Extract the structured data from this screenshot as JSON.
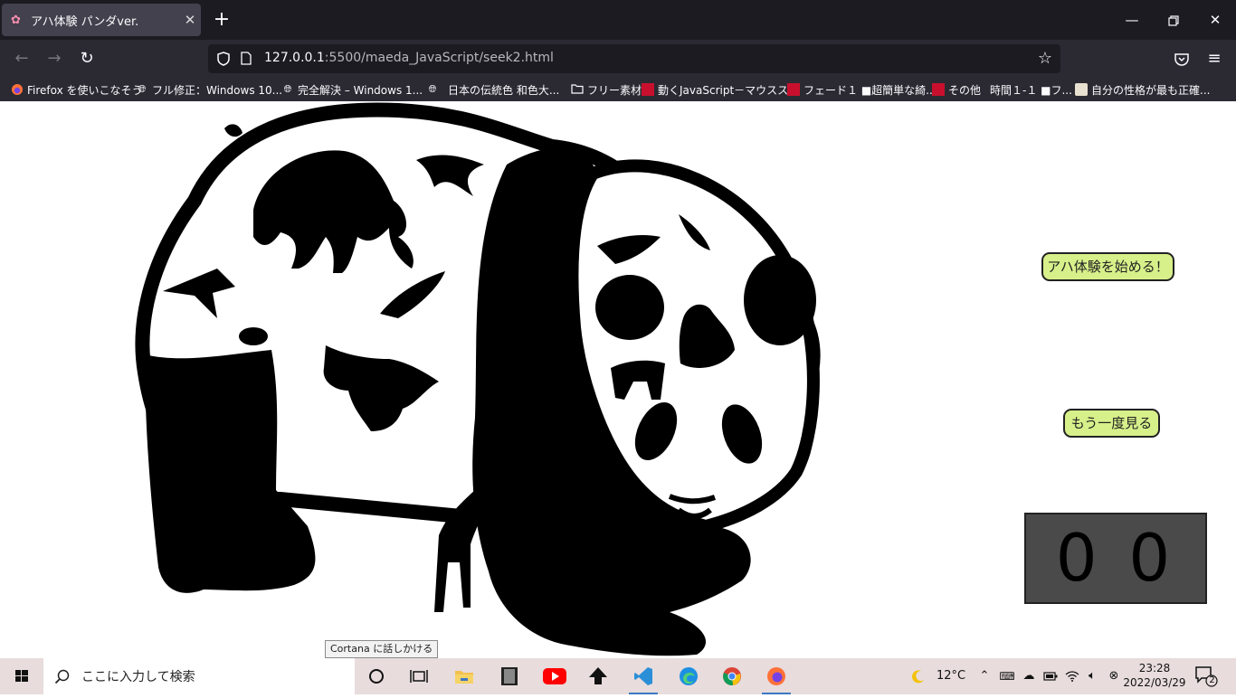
{
  "browser": {
    "tab": {
      "title": "アハ体験 パンダver.",
      "favicon": "flower-icon"
    },
    "url": {
      "host": "127.0.0.1",
      "rest": ":5500/maeda_JavaScript/seek2.html"
    },
    "bookmarks": [
      {
        "label": "Firefox を使いこなそう",
        "icon": "firefox-icon"
      },
      {
        "label": "フル修正：Windows 10...",
        "icon": "globe-icon"
      },
      {
        "label": "完全解決 – Windows 1...",
        "icon": "globe-icon"
      },
      {
        "label": "日本の伝統色 和色大...",
        "icon": "globe-icon"
      },
      {
        "label": "フリー素材",
        "icon": "folder-icon"
      },
      {
        "label": "動くJavaScript－マウスス...",
        "icon": "site-icon"
      },
      {
        "label": "フェード１ ■超簡単な綺...",
        "icon": "site-icon"
      },
      {
        "label": "その他",
        "icon": "site-icon"
      },
      {
        "label": "時間１-１ ■フ...",
        "icon": "none"
      },
      {
        "label": "自分の性格が最も正確...",
        "icon": "avatar-icon"
      }
    ]
  },
  "page": {
    "start_button": "アハ体験を始める！",
    "replay_button": "もう一度見る",
    "counter": "0 0",
    "colors": {
      "button_bg": "#d7f08a",
      "counter_bg": "#4a4a4a"
    }
  },
  "tooltip": "Cortana に話しかける",
  "taskbar": {
    "search_placeholder": "ここに入力して検索",
    "weather": "12°C",
    "time": "23:28",
    "date": "2022/03/29",
    "notifications": "2"
  }
}
